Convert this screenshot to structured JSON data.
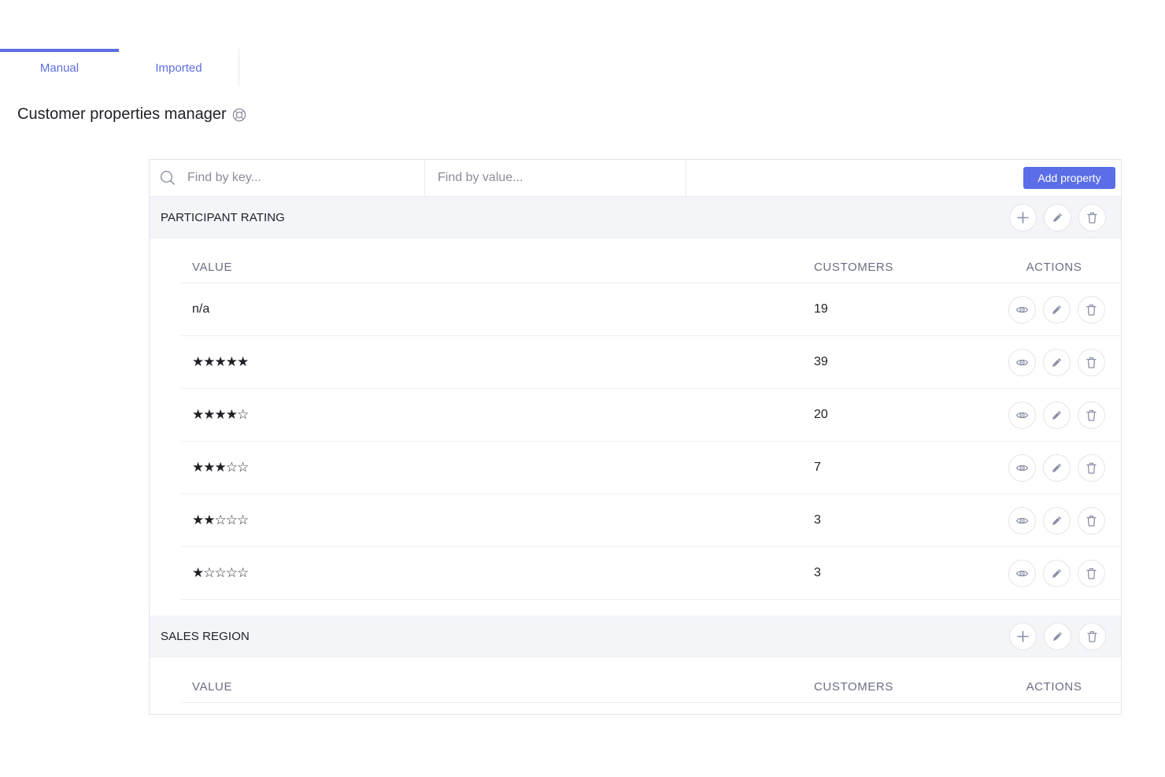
{
  "tabs": [
    {
      "label": "Manual",
      "active": true
    },
    {
      "label": "Imported",
      "active": false
    }
  ],
  "page": {
    "title": "Customer properties manager",
    "help_icon": "help-circle-icon"
  },
  "toolbar": {
    "key_placeholder": "Find by key...",
    "value_placeholder": "Find by value...",
    "add_label": "Add property"
  },
  "columns": {
    "value": "VALUE",
    "customers": "CUSTOMERS",
    "actions": "ACTIONS"
  },
  "groups": [
    {
      "name": "PARTICIPANT RATING",
      "rows": [
        {
          "value": "n/a",
          "customers": "19",
          "rating": null
        },
        {
          "value": "★★★★★",
          "customers": "39",
          "rating": 5
        },
        {
          "value": "★★★★☆",
          "customers": "20",
          "rating": 4
        },
        {
          "value": "★★★☆☆",
          "customers": "7",
          "rating": 3
        },
        {
          "value": "★★☆☆☆",
          "customers": "3",
          "rating": 2
        },
        {
          "value": "★☆☆☆☆",
          "customers": "3",
          "rating": 1
        }
      ]
    },
    {
      "name": "SALES REGION",
      "rows": []
    }
  ],
  "colors": {
    "accent": "#5b6ee1",
    "icon": "#8b90a3",
    "group_bg": "#f4f5f9"
  }
}
